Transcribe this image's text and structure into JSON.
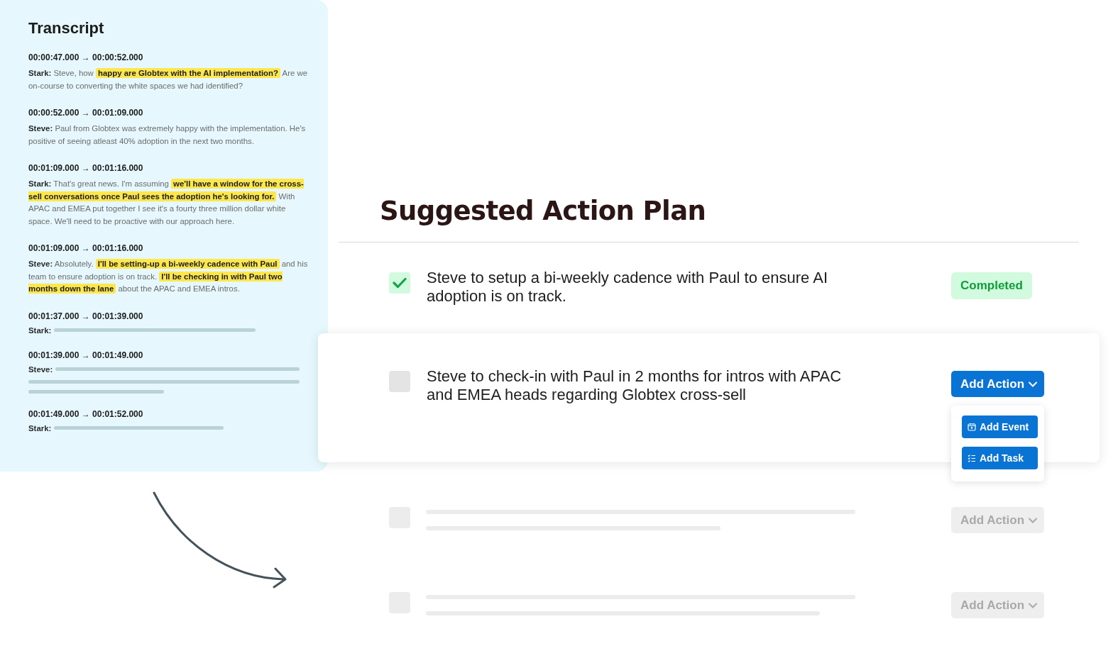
{
  "transcript": {
    "title": "Transcript",
    "entries": [
      {
        "kind": "text",
        "time": "00:00:47.000 → 00:00:52.000",
        "speaker": "Stark:",
        "segments": [
          {
            "text": "Steve, how",
            "highlighted": false
          },
          {
            "text": "happy are Globtex with the AI implementation?",
            "highlighted": true
          },
          {
            "text": "Are we on-course to converting the white spaces we had identified?",
            "highlighted": false
          }
        ]
      },
      {
        "kind": "text",
        "time": "00:00:52.000 → 00:01:09.000",
        "speaker": "Steve:",
        "segments": [
          {
            "text": "Paul from Globtex was extremely happy with the implementation. He's positive of seeing atleast 40% adoption in the next two months.",
            "highlighted": false
          }
        ]
      },
      {
        "kind": "text",
        "time": "00:01:09.000 → 00:01:16.000",
        "speaker": "Stark:",
        "segments": [
          {
            "text": "That's great news. I'm assuming",
            "highlighted": false
          },
          {
            "text": "we'll have a window for the cross-sell conversations once Paul sees the adoption he's looking for.",
            "highlighted": true
          },
          {
            "text": "With APAC and EMEA put together I see it's a fourty three million dollar white space. We'll need to be proactive with our approach here.",
            "highlighted": false
          }
        ]
      },
      {
        "kind": "text",
        "time": "00:01:09.000 → 00:01:16.000",
        "speaker": "Steve:",
        "segments": [
          {
            "text": "Absolutely.",
            "highlighted": false
          },
          {
            "text": "I'll be setting-up a bi-weekly cadence with Paul",
            "highlighted": true
          },
          {
            "text": "and his team to ensure adoption is on track.",
            "highlighted": false
          },
          {
            "text": "I'll be checking in with Paul two months down the lane",
            "highlighted": true
          },
          {
            "text": "about the APAC and EMEA intros.",
            "highlighted": false
          }
        ]
      },
      {
        "kind": "redacted",
        "time": "00:01:37.000 → 00:01:39.000",
        "speaker": "Stark:"
      },
      {
        "kind": "redacted",
        "time": "00:01:39.000 → 00:01:49.000",
        "speaker": "Steve:"
      },
      {
        "kind": "redacted",
        "time": "00:01:49.000 → 00:01:52.000",
        "speaker": "Stark:"
      }
    ]
  },
  "plan": {
    "title": "Suggested Action Plan",
    "items": [
      {
        "kind": "task",
        "text": "Steve to setup a bi-weekly cadence with Paul to ensure AI adoption is on track.",
        "checked": true,
        "focused": false,
        "status": "Completed"
      },
      {
        "kind": "task",
        "text": "Steve to check-in with Paul in 2 months for intros with APAC and EMEA heads regarding Globtex cross-sell",
        "checked": false,
        "focused": true,
        "action": {
          "label": "Add Action",
          "disabled": false,
          "menu": [
            {
              "kind": "event",
              "label": "Add Event"
            },
            {
              "kind": "task",
              "label": "Add Task"
            }
          ]
        }
      },
      {
        "kind": "placeholder",
        "checked": false,
        "action": {
          "label": "Add Action",
          "disabled": true
        }
      },
      {
        "kind": "placeholder",
        "checked": false,
        "action": {
          "label": "Add Action",
          "disabled": true
        }
      }
    ]
  }
}
